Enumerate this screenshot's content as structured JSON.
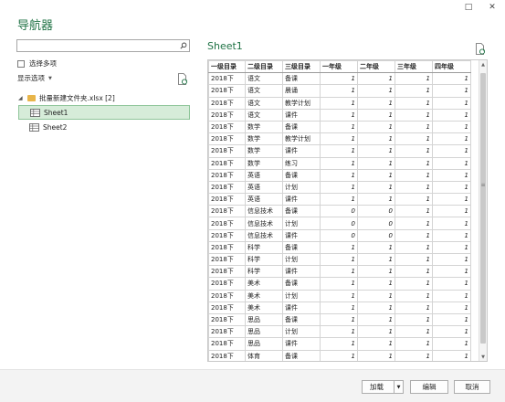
{
  "window": {
    "title": "导航器",
    "buttons": [
      "□",
      "✕"
    ]
  },
  "left_pane": {
    "search_placeholder": "",
    "multi_select_label": "选择多项",
    "display_options_label": "显示选项",
    "tree": {
      "folder_label": "批量新建文件夹.xlsx [2]",
      "items": [
        {
          "label": "Sheet1",
          "selected": true
        },
        {
          "label": "Sheet2",
          "selected": false
        }
      ]
    }
  },
  "preview": {
    "title": "Sheet1",
    "columns": [
      "一级目录",
      "二级目录",
      "三级目录",
      "一年级",
      "二年级",
      "三年级",
      "四年级"
    ],
    "rows": [
      [
        "2018下",
        "语文",
        "备课",
        "1",
        "1",
        "1",
        "1"
      ],
      [
        "2018下",
        "语文",
        "晨诵",
        "1",
        "1",
        "1",
        "1"
      ],
      [
        "2018下",
        "语文",
        "教学计划",
        "1",
        "1",
        "1",
        "1"
      ],
      [
        "2018下",
        "语文",
        "课件",
        "1",
        "1",
        "1",
        "1"
      ],
      [
        "2018下",
        "数学",
        "备课",
        "1",
        "1",
        "1",
        "1"
      ],
      [
        "2018下",
        "数学",
        "教学计划",
        "1",
        "1",
        "1",
        "1"
      ],
      [
        "2018下",
        "数学",
        "课件",
        "1",
        "1",
        "1",
        "1"
      ],
      [
        "2018下",
        "数学",
        "练习",
        "1",
        "1",
        "1",
        "1"
      ],
      [
        "2018下",
        "英语",
        "备课",
        "1",
        "1",
        "1",
        "1"
      ],
      [
        "2018下",
        "英语",
        "计划",
        "1",
        "1",
        "1",
        "1"
      ],
      [
        "2018下",
        "英语",
        "课件",
        "1",
        "1",
        "1",
        "1"
      ],
      [
        "2018下",
        "信息技术",
        "备课",
        "0",
        "0",
        "1",
        "1"
      ],
      [
        "2018下",
        "信息技术",
        "计划",
        "0",
        "0",
        "1",
        "1"
      ],
      [
        "2018下",
        "信息技术",
        "课件",
        "0",
        "0",
        "1",
        "1"
      ],
      [
        "2018下",
        "科学",
        "备课",
        "1",
        "1",
        "1",
        "1"
      ],
      [
        "2018下",
        "科学",
        "计划",
        "1",
        "1",
        "1",
        "1"
      ],
      [
        "2018下",
        "科学",
        "课件",
        "1",
        "1",
        "1",
        "1"
      ],
      [
        "2018下",
        "美术",
        "备课",
        "1",
        "1",
        "1",
        "1"
      ],
      [
        "2018下",
        "美术",
        "计划",
        "1",
        "1",
        "1",
        "1"
      ],
      [
        "2018下",
        "美术",
        "课件",
        "1",
        "1",
        "1",
        "1"
      ],
      [
        "2018下",
        "思品",
        "备课",
        "1",
        "1",
        "1",
        "1"
      ],
      [
        "2018下",
        "思品",
        "计划",
        "1",
        "1",
        "1",
        "1"
      ],
      [
        "2018下",
        "思品",
        "课件",
        "1",
        "1",
        "1",
        "1"
      ],
      [
        "2018下",
        "体育",
        "备课",
        "1",
        "1",
        "1",
        "1"
      ]
    ]
  },
  "footer": {
    "load_label": "加载",
    "edit_label": "编辑",
    "cancel_label": "取消"
  },
  "colors": {
    "accent": "#217346",
    "selected_bg": "#d6ecd9"
  }
}
